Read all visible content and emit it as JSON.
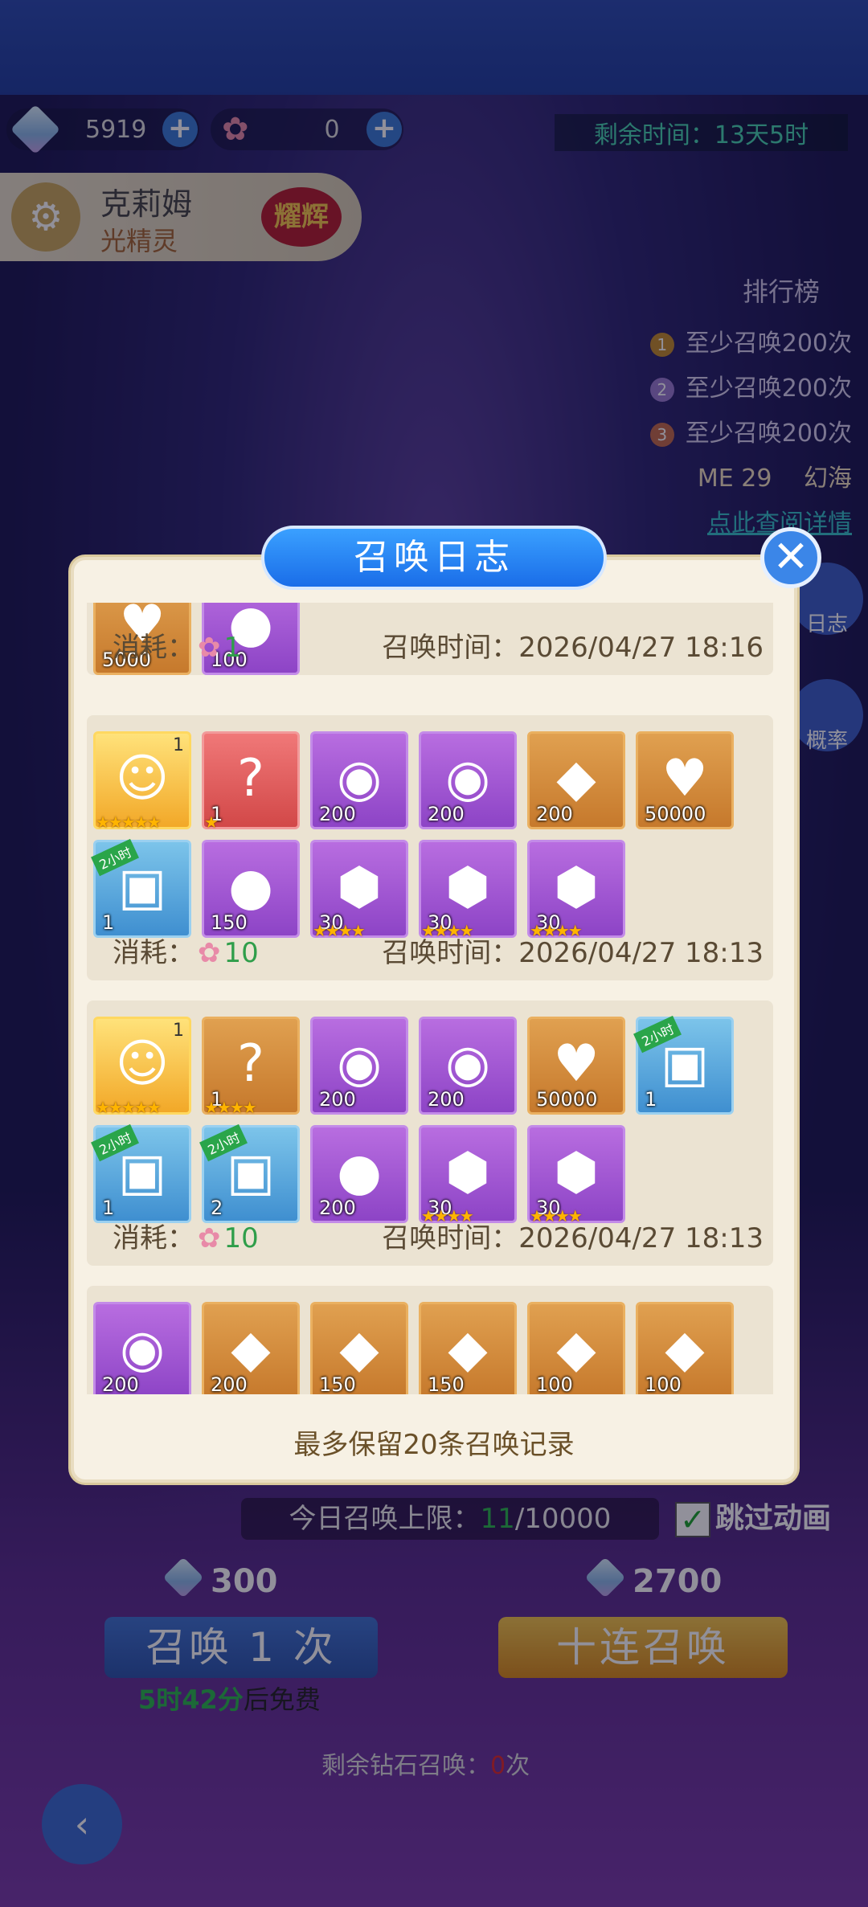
{
  "resources": {
    "gems": "5919",
    "flowers": "0"
  },
  "timer": "剩余时间：13天5时",
  "hero": {
    "name": "克莉姆",
    "type": "光精灵",
    "badge": "耀辉"
  },
  "ranking": {
    "title": "排行榜",
    "rows": [
      "至少召唤200次",
      "至少召唤200次",
      "至少召唤200次"
    ],
    "me_label": "ME",
    "me_rank": "29",
    "me_name": "幻海",
    "link": "点此查阅详情"
  },
  "side": {
    "log": "日志",
    "rate": "概率"
  },
  "modal": {
    "title": "召唤日志",
    "consume_label": "消耗：",
    "time_label": "召唤时间：",
    "footer": "最多保留20条召唤记录",
    "records": [
      {
        "cost": "1",
        "time": "2026/04/27 18:16",
        "items": [
          {
            "icon": "exp-heart",
            "q": "5000",
            "c": "o"
          },
          {
            "icon": "egg",
            "q": "100",
            "c": "p"
          }
        ]
      },
      {
        "cost": "10",
        "time": "2026/04/27 18:13",
        "items": [
          {
            "icon": "elf-card",
            "lv": "1",
            "stars": "★★★★★",
            "c": "y"
          },
          {
            "icon": "mystery-box",
            "q": "1",
            "stars": "★",
            "c": "r"
          },
          {
            "icon": "crystal-ball",
            "q": "200",
            "c": "p"
          },
          {
            "icon": "crystal-ball",
            "q": "200",
            "c": "p"
          },
          {
            "icon": "gem",
            "q": "200",
            "c": "o"
          },
          {
            "icon": "exp-heart",
            "q": "50000",
            "c": "o"
          },
          {
            "icon": "chest",
            "q": "1",
            "tag": "2小时",
            "c": "b"
          },
          {
            "icon": "egg",
            "q": "150",
            "c": "p"
          },
          {
            "icon": "purple-shard",
            "q": "30",
            "stars": "★★★★",
            "c": "p"
          },
          {
            "icon": "purple-shard",
            "q": "30",
            "stars": "★★★★",
            "c": "p"
          },
          {
            "icon": "purple-shard",
            "q": "30",
            "stars": "★★★★",
            "c": "p"
          }
        ]
      },
      {
        "cost": "10",
        "time": "2026/04/27 18:13",
        "items": [
          {
            "icon": "elf-card",
            "lv": "1",
            "stars": "★★★★★",
            "c": "y"
          },
          {
            "icon": "mystery-box",
            "q": "1",
            "stars": "★★★★",
            "c": "o"
          },
          {
            "icon": "crystal-ball",
            "q": "200",
            "c": "p"
          },
          {
            "icon": "crystal-ball",
            "q": "200",
            "c": "p"
          },
          {
            "icon": "exp-heart",
            "q": "50000",
            "c": "o"
          },
          {
            "icon": "chest",
            "q": "1",
            "tag": "2小时",
            "c": "b"
          },
          {
            "icon": "chest",
            "q": "1",
            "tag": "2小时",
            "c": "b"
          },
          {
            "icon": "coin-chest",
            "q": "2",
            "tag": "2小时",
            "c": "b"
          },
          {
            "icon": "egg",
            "q": "200",
            "c": "p"
          },
          {
            "icon": "purple-shard",
            "q": "30",
            "stars": "★★★★",
            "c": "p"
          },
          {
            "icon": "purple-shard",
            "q": "30",
            "stars": "★★★★",
            "c": "p"
          }
        ]
      },
      {
        "cost": "",
        "time": "",
        "items": [
          {
            "icon": "crystal-ball",
            "q": "200",
            "c": "p"
          },
          {
            "icon": "gem",
            "q": "200",
            "c": "o"
          },
          {
            "icon": "gem",
            "q": "150",
            "c": "o"
          },
          {
            "icon": "gem",
            "q": "150",
            "c": "o"
          },
          {
            "icon": "gem",
            "q": "100",
            "c": "o"
          },
          {
            "icon": "gem",
            "q": "100",
            "c": "o"
          }
        ]
      }
    ]
  },
  "bottom": {
    "limit_prefix": "今日召唤上限：",
    "limit_used": "11",
    "limit_total": "/10000",
    "skip": "跳过动画",
    "cost1": "300",
    "cost10": "2700",
    "btn1": "召唤 1 次",
    "btn10": "十连召唤",
    "free_time": "5时42分",
    "free_suffix": "后免费",
    "remain_prefix": "剩余钻石召唤：",
    "remain_count": "0",
    "remain_suffix": "次"
  }
}
